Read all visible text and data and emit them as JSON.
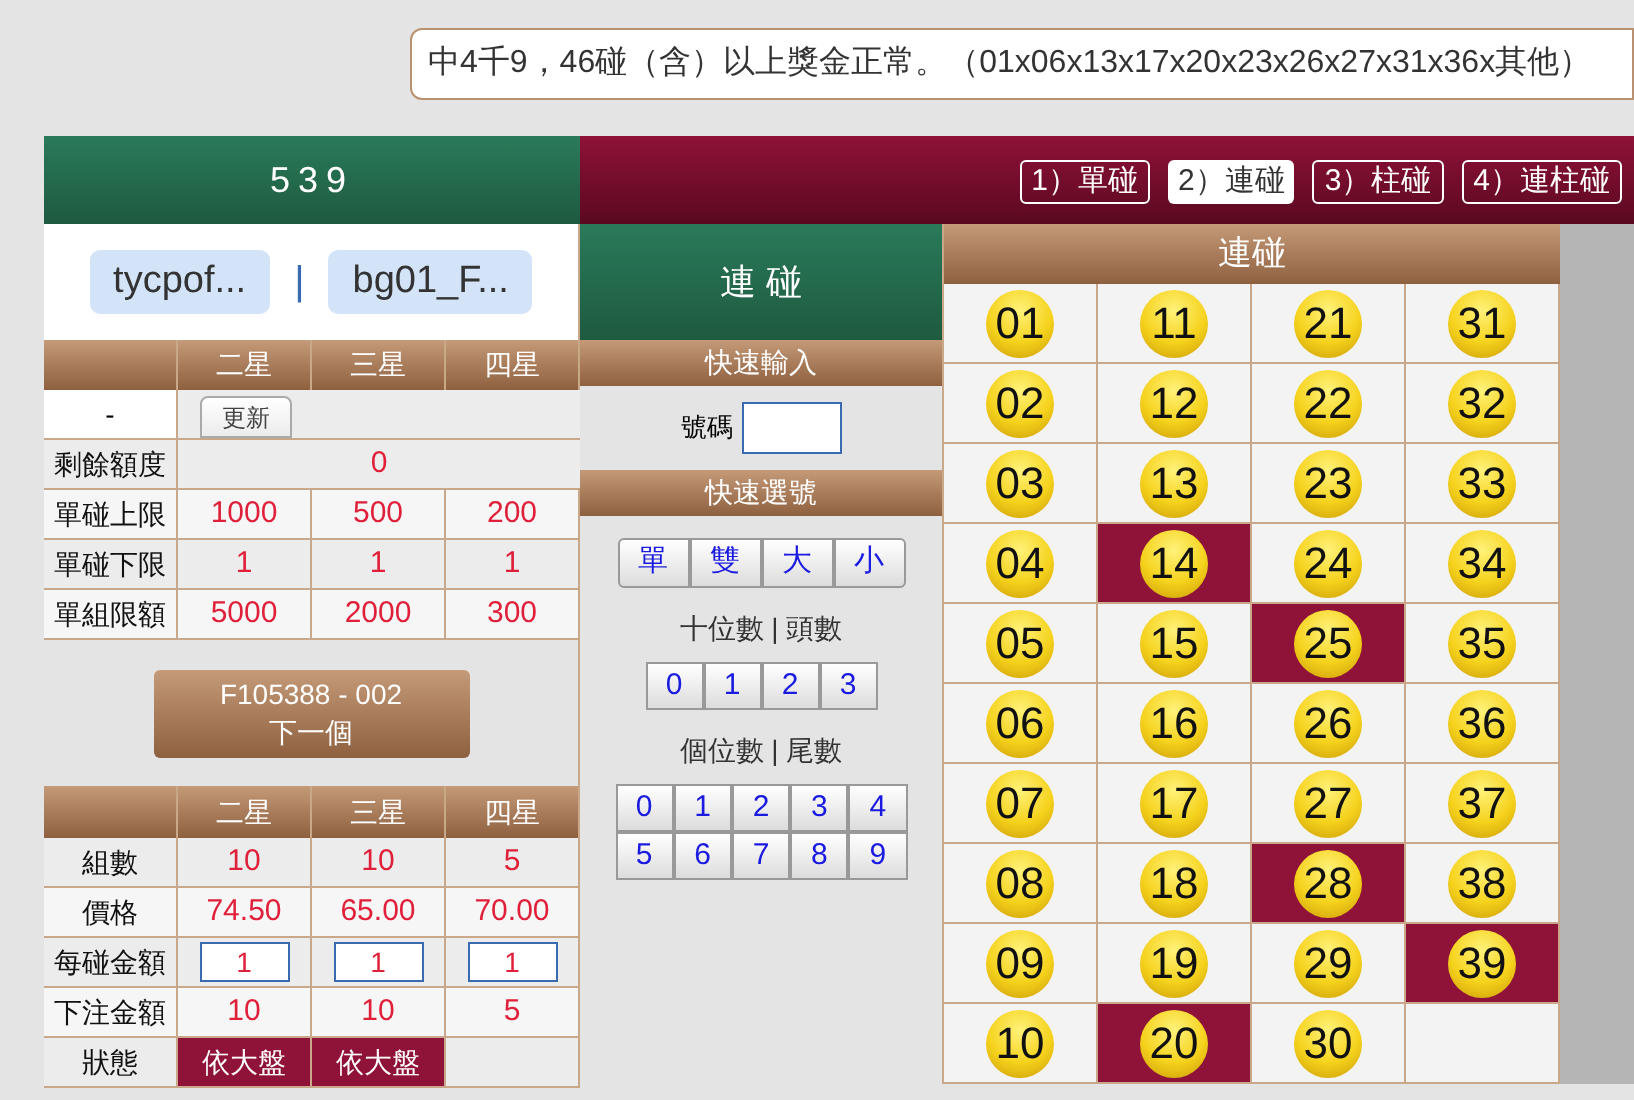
{
  "marquee": "中4千9，46碰（含）以上獎金正常。（01x06x13x17x20x23x26x27x31x36x其他）",
  "game_title": "539",
  "tabs": [
    {
      "label": "1）單碰",
      "selected": false
    },
    {
      "label": "2）連碰",
      "selected": true
    },
    {
      "label": "3）柱碰",
      "selected": false
    },
    {
      "label": "4）連柱碰",
      "selected": false
    }
  ],
  "users": [
    "tycpof...",
    "bg01_F..."
  ],
  "user_separator": "|",
  "limits": {
    "columns": [
      "二星",
      "三星",
      "四星"
    ],
    "refresh_row": {
      "label": "-",
      "button": "更新"
    },
    "rows": [
      {
        "kind": "span",
        "label": "剩餘額度",
        "values": [
          "0"
        ]
      },
      {
        "kind": "cols",
        "label": "單碰上限",
        "values": [
          "1000",
          "500",
          "200"
        ]
      },
      {
        "kind": "cols",
        "label": "單碰下限",
        "values": [
          "1",
          "1",
          "1"
        ]
      },
      {
        "kind": "cols",
        "label": "單組限額",
        "values": [
          "5000",
          "2000",
          "300"
        ]
      }
    ]
  },
  "next_button": {
    "code": "F105388 - 002",
    "label": "下一個"
  },
  "bet_table": {
    "columns": [
      "二星",
      "三星",
      "四星"
    ],
    "rows": [
      {
        "kind": "text",
        "label": "組數",
        "values": [
          "10",
          "10",
          "5"
        ]
      },
      {
        "kind": "text",
        "label": "價格",
        "values": [
          "74.50",
          "65.00",
          "70.00"
        ]
      },
      {
        "kind": "input",
        "label": "每碰金額",
        "values": [
          "1",
          "1",
          "1"
        ]
      },
      {
        "kind": "text",
        "label": "下注金額",
        "values": [
          "10",
          "10",
          "5"
        ]
      },
      {
        "kind": "status",
        "label": "狀態",
        "values": [
          "依大盤",
          "依大盤"
        ]
      }
    ]
  },
  "mode_title": "連 碰",
  "quick_input": {
    "title": "快速輸入",
    "label": "號碼"
  },
  "quick_pick": {
    "title": "快速選號",
    "parity_buttons": [
      "單",
      "雙",
      "大",
      "小"
    ],
    "tens_label": "十位數 | 頭數",
    "tens_buttons": [
      "0",
      "1",
      "2",
      "3"
    ],
    "units_label": "個位數 | 尾數",
    "units_buttons": [
      "0",
      "1",
      "2",
      "3",
      "4",
      "5",
      "6",
      "7",
      "8",
      "9"
    ]
  },
  "grid": {
    "title": "連碰",
    "numbers": [
      {
        "label": "01",
        "selected": false
      },
      {
        "label": "02",
        "selected": false
      },
      {
        "label": "03",
        "selected": false
      },
      {
        "label": "04",
        "selected": false
      },
      {
        "label": "05",
        "selected": false
      },
      {
        "label": "06",
        "selected": false
      },
      {
        "label": "07",
        "selected": false
      },
      {
        "label": "08",
        "selected": false
      },
      {
        "label": "09",
        "selected": false
      },
      {
        "label": "10",
        "selected": false
      },
      {
        "label": "11",
        "selected": false
      },
      {
        "label": "12",
        "selected": false
      },
      {
        "label": "13",
        "selected": false
      },
      {
        "label": "14",
        "selected": true
      },
      {
        "label": "15",
        "selected": false
      },
      {
        "label": "16",
        "selected": false
      },
      {
        "label": "17",
        "selected": false
      },
      {
        "label": "18",
        "selected": false
      },
      {
        "label": "19",
        "selected": false
      },
      {
        "label": "20",
        "selected": true
      },
      {
        "label": "21",
        "selected": false
      },
      {
        "label": "22",
        "selected": false
      },
      {
        "label": "23",
        "selected": false
      },
      {
        "label": "24",
        "selected": false
      },
      {
        "label": "25",
        "selected": true
      },
      {
        "label": "26",
        "selected": false
      },
      {
        "label": "27",
        "selected": false
      },
      {
        "label": "28",
        "selected": true
      },
      {
        "label": "29",
        "selected": false
      },
      {
        "label": "30",
        "selected": false
      },
      {
        "label": "31",
        "selected": false
      },
      {
        "label": "32",
        "selected": false
      },
      {
        "label": "33",
        "selected": false
      },
      {
        "label": "34",
        "selected": false
      },
      {
        "label": "35",
        "selected": false
      },
      {
        "label": "36",
        "selected": false
      },
      {
        "label": "37",
        "selected": false
      },
      {
        "label": "38",
        "selected": false
      },
      {
        "label": "39",
        "selected": true
      }
    ]
  }
}
